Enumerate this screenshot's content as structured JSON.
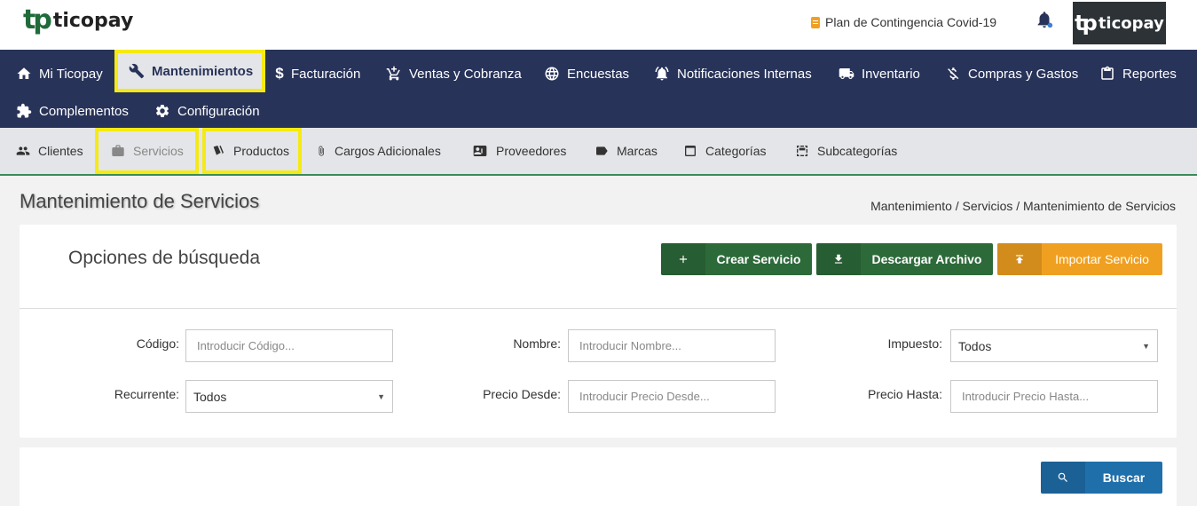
{
  "brand": {
    "logo_mark": "tp",
    "logo_text": "ticopay"
  },
  "header": {
    "contingency_label": "Plan de Contingencia Covid-19",
    "user_logo_mark": "tp",
    "user_logo_text": "ticopay"
  },
  "mainnav": {
    "items": [
      {
        "label": "Mi Ticopay",
        "icon": "home-icon"
      },
      {
        "label": "Mantenimientos",
        "icon": "wrench-icon",
        "active": true
      },
      {
        "label": "Facturación",
        "icon": "dollar-icon"
      },
      {
        "label": "Ventas y Cobranza",
        "icon": "cart-icon"
      },
      {
        "label": "Encuestas",
        "icon": "globe-icon"
      },
      {
        "label": "Notificaciones Internas",
        "icon": "alarm-icon"
      },
      {
        "label": "Inventario",
        "icon": "truck-icon"
      },
      {
        "label": "Compras y Gastos",
        "icon": "money-off-icon"
      },
      {
        "label": "Reportes",
        "icon": "clipboard-icon"
      },
      {
        "label": "Complementos",
        "icon": "puzzle-icon"
      },
      {
        "label": "Configuración",
        "icon": "gear-icon"
      }
    ]
  },
  "subnav": {
    "items": [
      {
        "label": "Clientes",
        "icon": "people-icon"
      },
      {
        "label": "Servicios",
        "icon": "briefcase-icon",
        "current": true
      },
      {
        "label": "Productos",
        "icon": "tags-icon"
      },
      {
        "label": "Cargos Adicionales",
        "icon": "paperclip-icon"
      },
      {
        "label": "Proveedores",
        "icon": "contact-card-icon"
      },
      {
        "label": "Marcas",
        "icon": "label-icon"
      },
      {
        "label": "Categorías",
        "icon": "window-icon"
      },
      {
        "label": "Subcategorías",
        "icon": "dashed-window-icon"
      }
    ]
  },
  "page": {
    "title": "Mantenimiento de Servicios",
    "breadcrumb": "Mantenimiento / Servicios / Mantenimiento de Servicios"
  },
  "search": {
    "title": "Opciones de búsqueda",
    "buttons": {
      "create": "Crear Servicio",
      "download": "Descargar Archivo",
      "import": "Importar Servicio",
      "search": "Buscar"
    },
    "fields": {
      "codigo_label": "Código:",
      "codigo_placeholder": "Introducir Código...",
      "nombre_label": "Nombre:",
      "nombre_placeholder": "Introducir Nombre...",
      "impuesto_label": "Impuesto:",
      "impuesto_value": "Todos",
      "recurrente_label": "Recurrente:",
      "recurrente_value": "Todos",
      "precio_desde_label": "Precio Desde:",
      "precio_desde_placeholder": "Introducir Precio Desde...",
      "precio_hasta_label": "Precio Hasta:",
      "precio_hasta_placeholder": "Introducir Precio Hasta..."
    }
  },
  "colors": {
    "nav_bg": "#283359",
    "subnav_bg": "#e4e5e8",
    "highlight": "#f5ea14",
    "btn_green": "#2d6a3a",
    "btn_orange": "#f0a020",
    "btn_blue": "#1f6fab"
  }
}
